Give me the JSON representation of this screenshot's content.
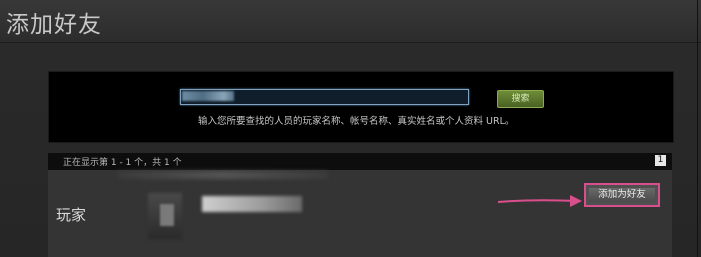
{
  "header": {
    "title": "添加好友"
  },
  "search": {
    "input_value": "",
    "button_label": "搜索",
    "hint": "输入您所要查找的人员的玩家名称、帐号名称、真实姓名或个人资料 URL。"
  },
  "results": {
    "status": "正在显示第 1 - 1 个，共 1 个",
    "page": "1"
  },
  "player": {
    "label": "玩家",
    "add_friend_label": "添加为好友"
  },
  "colors": {
    "accent_green": "#5a7a2c",
    "highlight_pink": "#d94f8d"
  }
}
